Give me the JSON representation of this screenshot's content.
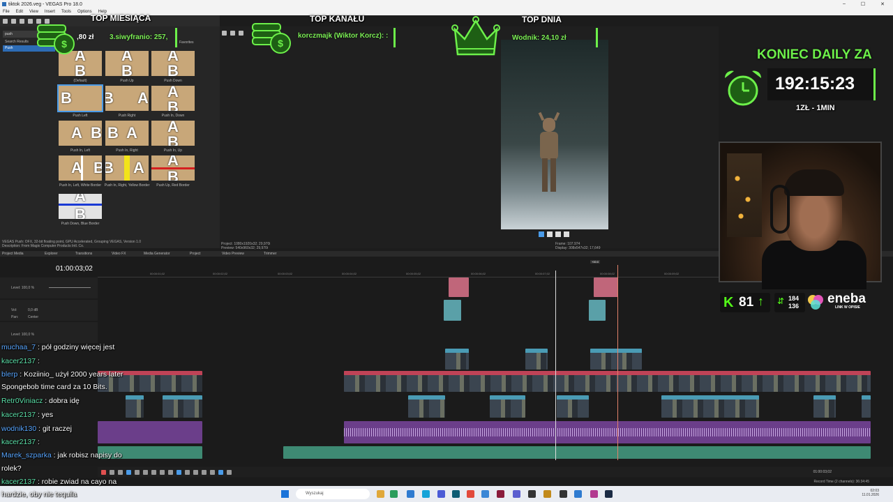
{
  "window": {
    "title": "tiktok 2026.veg - VEGAS Pro 18.0",
    "controls": [
      "–",
      "☐",
      "✕"
    ]
  },
  "menu": [
    "File",
    "Edit",
    "View",
    "Insert",
    "Tools",
    "Options",
    "Help"
  ],
  "left_panel": {
    "search_value": "push",
    "tree": [
      "Search Results",
      "Push"
    ],
    "favorites_label": "Favorites",
    "thumbnails": [
      {
        "label": "(Default)"
      },
      {
        "label": "Push Up"
      },
      {
        "label": "Push Down"
      },
      {
        "label": "Push Left"
      },
      {
        "label": "Push Right"
      },
      {
        "label": "Push In, Down"
      },
      {
        "label": "Push In, Left"
      },
      {
        "label": "Push In, Right"
      },
      {
        "label": "Push In, Up"
      },
      {
        "label": "Push In, Left, White Border"
      },
      {
        "label": "Push In, Right, Yellow Border"
      },
      {
        "label": "Push Up, Red Border"
      },
      {
        "label": "Push Down, Blue Border"
      }
    ],
    "status_line1": "VEGAS Push: OFX, 32-bit floating point, GPU Accelerated, Grouping VEGAS, Version 1.0",
    "status_line2": "Description: From Magix Computer Products Intl. Co."
  },
  "panel_tabs": [
    "Project Media",
    "Explorer",
    "Transitions",
    "Video FX",
    "Media Generator",
    "Project",
    "Video Preview",
    "Trimmer"
  ],
  "preview": {
    "project_info": "Project:   1080x1920x32; 29,970i",
    "preview_info": "Preview:   540x960x32; 29,970i",
    "frame_info": "Frame:      107.974",
    "display_info": "Display:   308x547x32; 17,649"
  },
  "timeline": {
    "timecode": "01:00:03;02",
    "track_labels": {
      "level": "Level: 100,0 %",
      "vol": "Vol:",
      "vol_val": "0,0 dB",
      "pan": "Pan:",
      "pan_val": "Center"
    },
    "marker": "+00:0",
    "ruler_ticks": [
      "00:00:01;02",
      "00:00:02;02",
      "00:00:03;02",
      "00:00:04;02",
      "00:00:05;02",
      "00:00:06;02",
      "00:00:07;02",
      "00:00:08;02",
      "00:00:09;02",
      "00:00:10;02",
      "00:00:11;02"
    ],
    "end_time": "01:00:03;02",
    "record_time": "Record Time (2 channels): 36:34:45"
  },
  "overlay": {
    "top_month": {
      "title": "TOP MIESIĄCA",
      "amount": ",80 zł",
      "entry": "3.siwyfranio: 257,"
    },
    "top_channel": {
      "title": "TOP KANAŁU",
      "entry": "korczmajk (Wiktor Korcz): :"
    },
    "top_day": {
      "title": "TOP DNIA",
      "entry": "Wodnik: 24,10 zł"
    },
    "daily": {
      "title": "KONIEC DAILY ZA",
      "timer": "192:15:23",
      "rate": "1ZŁ - 1MIN"
    },
    "stats": {
      "k_value": "81",
      "up": "184",
      "down": "136",
      "sponsor": "eneba",
      "sponsor_sub": "LINK W OPISIE"
    }
  },
  "chat": [
    {
      "user": "muchaa_7",
      "text": ": pół godziny więcej jest"
    },
    {
      "user": "kacer2137",
      "text": ":"
    },
    {
      "user": "blerp",
      "text": ": Koziinio_ użył 2000 years later"
    },
    {
      "user": "",
      "text": "Spongebob time card za 10 Bits."
    },
    {
      "user": "Retr0Viniacz",
      "text": ": dobra idę"
    },
    {
      "user": "kacer2137",
      "text": ": yes"
    },
    {
      "user": "wodnik130",
      "text": ": git raczej"
    },
    {
      "user": "kacer2137",
      "text": ":"
    },
    {
      "user": "Marek_szparka",
      "text": ": jak robisz napisy do"
    },
    {
      "user": "",
      "text": "rolek?"
    },
    {
      "user": "kacer2137",
      "text": ": robie zwiad na cayo na"
    },
    {
      "user": "",
      "text": "hardzie, oby nie tequila"
    }
  ],
  "taskbar": {
    "search_placeholder": "Wyszukaj",
    "time": "02:03",
    "date": "11.01.2026"
  },
  "colors": {
    "accent_green": "#6df04a",
    "vegas_blue": "#4a9be8",
    "clip_red": "#c04357",
    "audio_purple": "#6b3e8a"
  }
}
